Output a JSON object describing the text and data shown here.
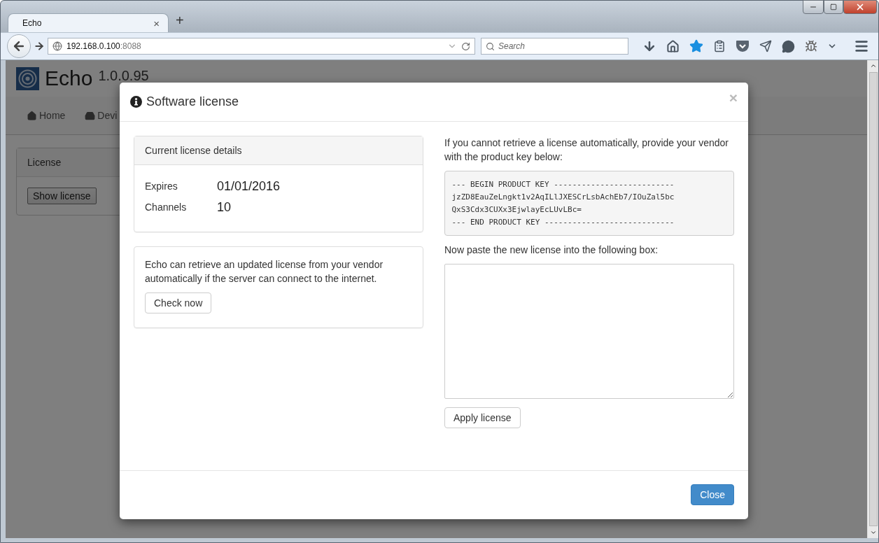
{
  "browser": {
    "tab": {
      "title": "Echo",
      "close": "×"
    },
    "new_tab": "+",
    "url": {
      "host": "192.168.0.100",
      "port": ":8088"
    },
    "search": {
      "placeholder": "Search"
    }
  },
  "page": {
    "app_name": "Echo",
    "version": "1.0.0.95",
    "nav": [
      {
        "label": "Home",
        "kind": "home"
      },
      {
        "label": "Devi",
        "kind": "device"
      }
    ],
    "panel": {
      "title": "License",
      "button": "Show license"
    }
  },
  "modal": {
    "title": "Software license",
    "close": "×",
    "details": {
      "title": "Current license details",
      "rows": [
        {
          "label": "Expires",
          "value": "01/01/2016"
        },
        {
          "label": "Channels",
          "value": "10"
        }
      ]
    },
    "auto": {
      "text": "Echo can retrieve an updated license from your vendor automatically if the server can connect to the internet.",
      "button": "Check now"
    },
    "manual": {
      "instructions": "If you cannot retrieve a license automatically, provide your vendor with the product key below:",
      "product_key": [
        "--- BEGIN PRODUCT KEY --------------------------",
        "jzZD8EauZeLngkt1v2AqILlJXESCrLsbAchEb7/IOuZal5bc",
        "QxS3Cdx3CUXx3EjwlayEcLUvLBc=",
        "--- END PRODUCT KEY ----------------------------"
      ],
      "paste_label": "Now paste the new license into the following box:",
      "apply_button": "Apply license"
    },
    "footer_button": "Close"
  }
}
